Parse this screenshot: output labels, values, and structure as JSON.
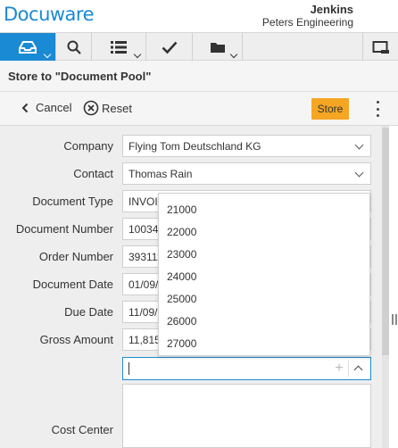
{
  "app": {
    "logo_text": "Docuware",
    "user_name": "Jenkins",
    "organization": "Peters Engineering",
    "brand_color": "#1a8ad4",
    "accent_color": "#f5a623"
  },
  "toolbar": {
    "items": [
      {
        "name": "tray",
        "icon": "tray-icon",
        "active": true,
        "has_menu": true
      },
      {
        "name": "search",
        "icon": "search-icon",
        "active": false,
        "has_menu": false
      },
      {
        "name": "list",
        "icon": "list-icon",
        "active": false,
        "has_menu": true
      },
      {
        "name": "tasks",
        "icon": "checkmark-icon",
        "active": false,
        "has_menu": false
      },
      {
        "name": "folder",
        "icon": "folder-icon",
        "active": false,
        "has_menu": true
      },
      {
        "name": "window",
        "icon": "window-icon",
        "active": false,
        "has_menu": false
      }
    ]
  },
  "page": {
    "title": "Store to \"Document Pool\""
  },
  "actions": {
    "cancel_label": "Cancel",
    "reset_label": "Reset",
    "store_label": "Store"
  },
  "form": {
    "fields": [
      {
        "label": "Company",
        "value": "Flying Tom Deutschland KG",
        "type": "select"
      },
      {
        "label": "Contact",
        "value": "Thomas Rain",
        "type": "select"
      },
      {
        "label": "Document Type",
        "value": "INVOIC",
        "type": "text"
      },
      {
        "label": "Document Number",
        "value": "100347",
        "type": "text"
      },
      {
        "label": "Order Number",
        "value": "393111",
        "type": "text"
      },
      {
        "label": "Document Date",
        "value": "01/09/",
        "type": "text"
      },
      {
        "label": "Due Date",
        "value": "11/09/",
        "type": "text"
      },
      {
        "label": "Gross Amount",
        "value": "11,815",
        "type": "text"
      },
      {
        "label": "Cost Center",
        "value": "",
        "type": "combo"
      }
    ]
  },
  "dropdown": {
    "options": [
      "21000",
      "22000",
      "23000",
      "24000",
      "25000",
      "26000",
      "27000"
    ]
  }
}
